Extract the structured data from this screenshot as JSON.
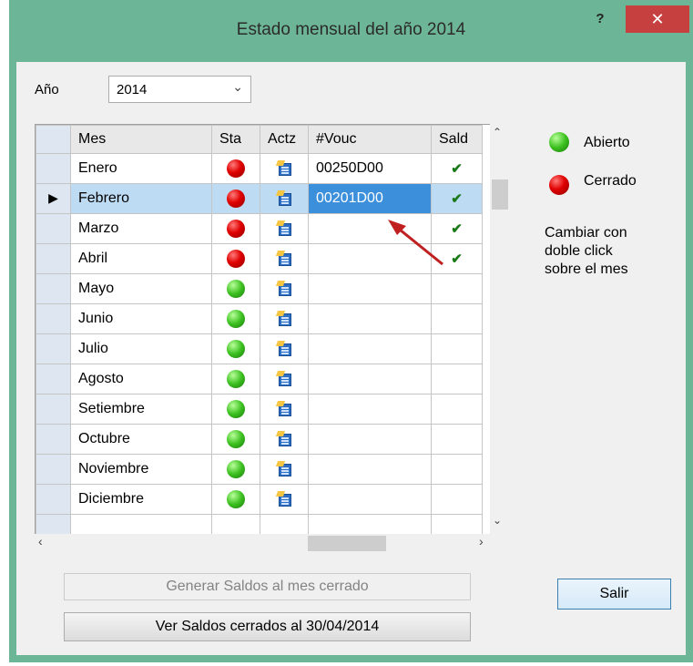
{
  "window": {
    "title": "Estado mensual del año 2014",
    "help_label": "?",
    "close_label": "✕"
  },
  "year": {
    "label": "Año",
    "value": "2014"
  },
  "grid": {
    "columns": [
      "Mes",
      "Sta",
      "Actz",
      "#Vouc",
      "Sald"
    ],
    "rows": [
      {
        "mes": "Enero",
        "status": "cerrado",
        "vouc": "00250D00",
        "sald": "✔"
      },
      {
        "mes": "Febrero",
        "status": "cerrado",
        "vouc": "00201D00",
        "sald": "✔",
        "selected": true
      },
      {
        "mes": "Marzo",
        "status": "cerrado",
        "vouc": "",
        "sald": "✔"
      },
      {
        "mes": "Abril",
        "status": "cerrado",
        "vouc": "",
        "sald": "✔"
      },
      {
        "mes": "Mayo",
        "status": "abierto",
        "vouc": "",
        "sald": ""
      },
      {
        "mes": "Junio",
        "status": "abierto",
        "vouc": "",
        "sald": ""
      },
      {
        "mes": "Julio",
        "status": "abierto",
        "vouc": "",
        "sald": ""
      },
      {
        "mes": "Agosto",
        "status": "abierto",
        "vouc": "",
        "sald": ""
      },
      {
        "mes": "Setiembre",
        "status": "abierto",
        "vouc": "",
        "sald": ""
      },
      {
        "mes": "Octubre",
        "status": "abierto",
        "vouc": "",
        "sald": ""
      },
      {
        "mes": "Noviembre",
        "status": "abierto",
        "vouc": "",
        "sald": ""
      },
      {
        "mes": "Diciembre",
        "status": "abierto",
        "vouc": "",
        "sald": ""
      }
    ],
    "current_row_marker": "▶"
  },
  "legend": {
    "open_label": "Abierto",
    "closed_label": "Cerrado",
    "hint_lines": [
      "Cambiar con",
      "doble click",
      "sobre el mes"
    ]
  },
  "buttons": {
    "generate_label": "Generar Saldos al mes cerrado",
    "view_label": "Ver Saldos cerrados al 30/04/2014",
    "exit_label": "Salir"
  },
  "scroll": {
    "up": "⌃",
    "down": "⌄",
    "left": "‹",
    "right": "›"
  },
  "colors": {
    "window_frame": "#6cb596",
    "close_button": "#c74040",
    "selected_row": "#bedbf4",
    "active_cell": "#3b8fdb",
    "status_open": "#3cc01f",
    "status_closed": "#e00000",
    "annotation_arrow": "#c02020"
  },
  "icons": {
    "status": "status-dot-icon",
    "update": "update-document-icon",
    "saldo": "check-icon",
    "row_pointer": "row-pointer-icon"
  }
}
